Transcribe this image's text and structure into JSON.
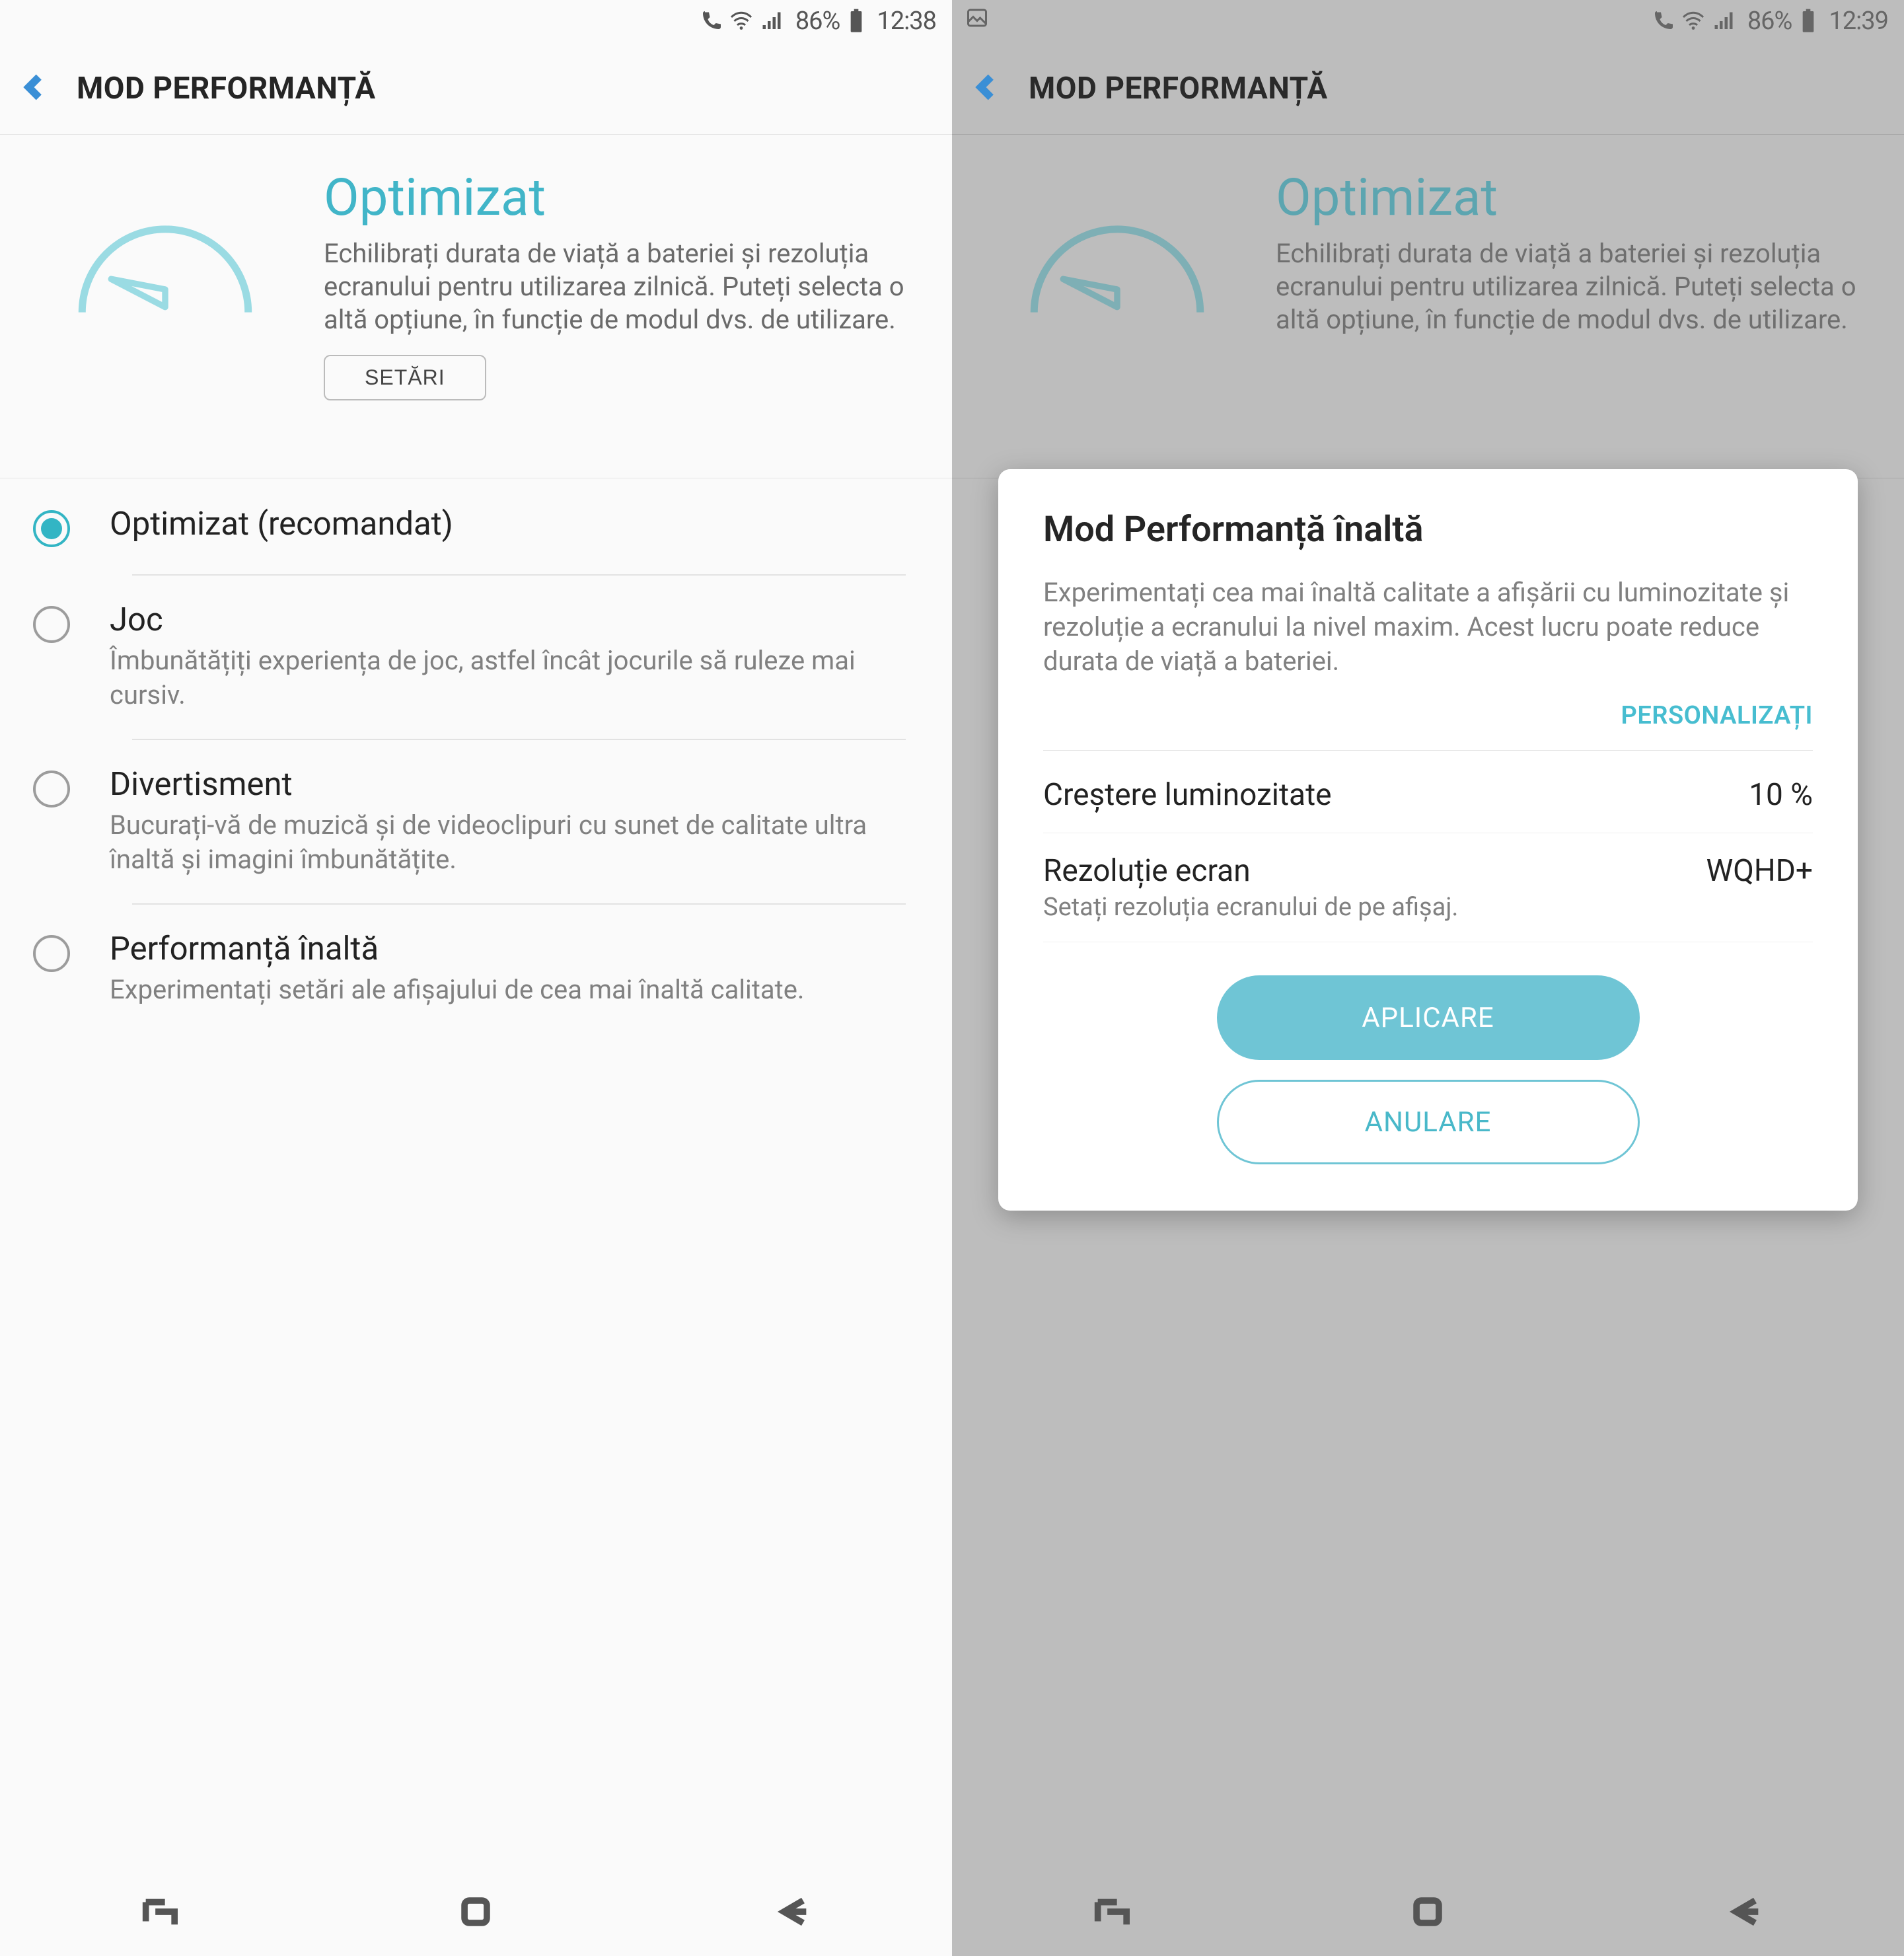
{
  "colors": {
    "accent": "#41b5c8",
    "text_muted": "#808080"
  },
  "left": {
    "status": {
      "battery_pct": "86%",
      "time": "12:38"
    },
    "toolbar_title": "MOD PERFORMANȚĂ",
    "hero": {
      "title": "Optimizat",
      "desc": "Echilibrați durata de viață a bateriei și rezoluția ecranului pentru utilizarea zilnică. Puteți selecta o altă opțiune, în funcție de modul dvs. de utilizare.",
      "settings_btn": "SETĂRI"
    },
    "options": [
      {
        "title": "Optimizat (recomandat)",
        "desc": "",
        "selected": true
      },
      {
        "title": "Joc",
        "desc": "Îmbunătățiți experiența de joc, astfel încât jocurile să ruleze mai cursiv.",
        "selected": false
      },
      {
        "title": "Divertisment",
        "desc": "Bucurați-vă de muzică și de videoclipuri cu sunet de calitate ultra înaltă și imagini îmbunătățite.",
        "selected": false
      },
      {
        "title": "Performanță înaltă",
        "desc": "Experimentați setări ale afișajului de cea mai înaltă calitate.",
        "selected": false
      }
    ]
  },
  "right": {
    "status": {
      "battery_pct": "86%",
      "time": "12:39"
    },
    "toolbar_title": "MOD PERFORMANȚĂ",
    "hero": {
      "title": "Optimizat",
      "desc": "Echilibrați durata de viață a bateriei și rezoluția ecranului pentru utilizarea zilnică. Puteți selecta o altă opțiune, în funcție de modul dvs. de utilizare."
    },
    "dialog": {
      "title": "Mod Performanță înaltă",
      "desc": "Experimentați cea mai înaltă calitate a afișării cu luminozitate și rezoluție a ecranului la nivel maxim. Acest lucru poate reduce durata de viață a bateriei.",
      "customize": "PERSONALIZAȚI",
      "rows": [
        {
          "label": "Creștere luminozitate",
          "value": "10 %",
          "sub": ""
        },
        {
          "label": "Rezoluție ecran",
          "value": "WQHD+",
          "sub": "Setați rezoluția ecranului de pe afișaj."
        }
      ],
      "apply": "APLICARE",
      "cancel": "ANULARE"
    }
  }
}
